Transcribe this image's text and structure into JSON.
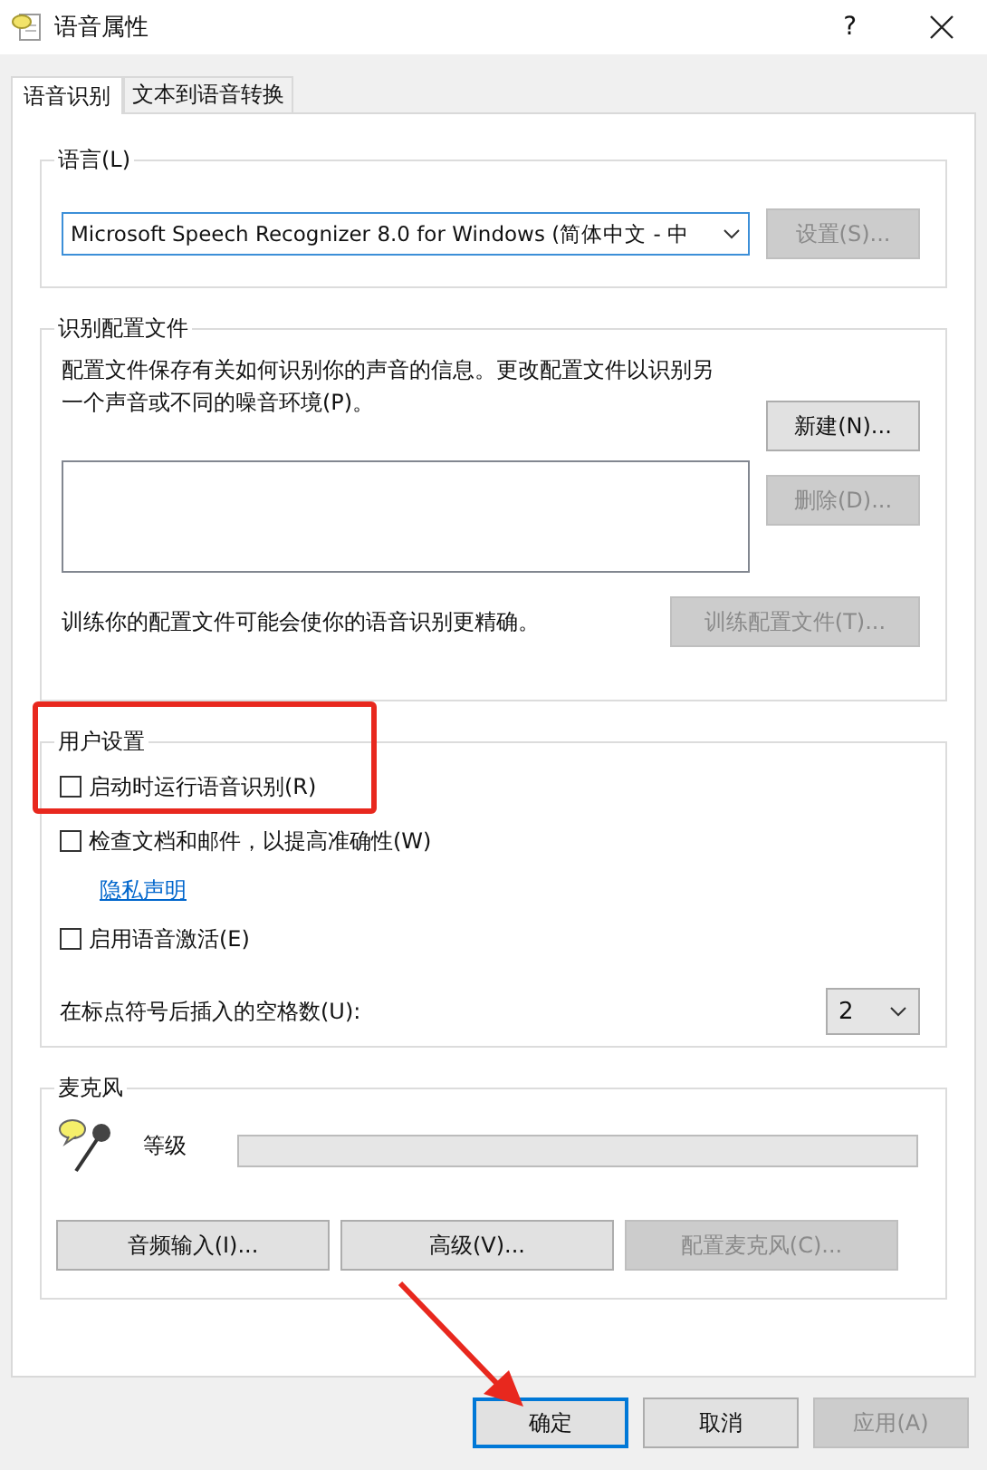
{
  "window": {
    "title": "语音属性",
    "help": "?"
  },
  "tabs": [
    {
      "label": "语音识别",
      "selected": true
    },
    {
      "label": "文本到语音转换",
      "selected": false
    }
  ],
  "language": {
    "legend": "语言(L)",
    "value": "Microsoft Speech Recognizer 8.0 for Windows (简体中文 - 中",
    "button": {
      "label": "设置(S)...",
      "disabled": true
    }
  },
  "profiles": {
    "legend": "识别配置文件",
    "description": "配置文件保存有关如何识别你的声音的信息。更改配置文件以识别另一个声音或不同的噪音环境(P)。",
    "buttons": [
      {
        "label": "新建(N)...",
        "disabled": false
      },
      {
        "label": "删除(D)...",
        "disabled": true
      }
    ],
    "train_text": "训练你的配置文件可能会使你的语音识别更精确。",
    "train_button": {
      "label": "训练配置文件(T)...",
      "disabled": true
    }
  },
  "user_settings": {
    "legend": "用户设置",
    "options": [
      {
        "kind": "checkbox",
        "label": "启动时运行语音识别(R)",
        "checked": false
      },
      {
        "kind": "checkbox",
        "label": "检查文档和邮件，以提高准确性(W)",
        "checked": false
      },
      {
        "kind": "link",
        "label": "隐私声明"
      },
      {
        "kind": "checkbox",
        "label": "启用语音激活(E)",
        "checked": false
      }
    ],
    "spaces_label": "在标点符号后插入的空格数(U):",
    "spaces_value": "2"
  },
  "microphone": {
    "legend": "麦克风",
    "level_label": "等级",
    "buttons": [
      {
        "label": "音频输入(I)...",
        "disabled": false
      },
      {
        "label": "高级(V)...",
        "disabled": false
      },
      {
        "label": "配置麦克风(C)...",
        "disabled": true
      }
    ]
  },
  "dialog_buttons": [
    {
      "label": "确定",
      "disabled": false,
      "default": true
    },
    {
      "label": "取消",
      "disabled": false,
      "default": false
    },
    {
      "label": "应用(A)",
      "disabled": true,
      "default": false
    }
  ],
  "annotations": [
    {
      "kind": "highlight-box"
    },
    {
      "kind": "arrow"
    }
  ]
}
